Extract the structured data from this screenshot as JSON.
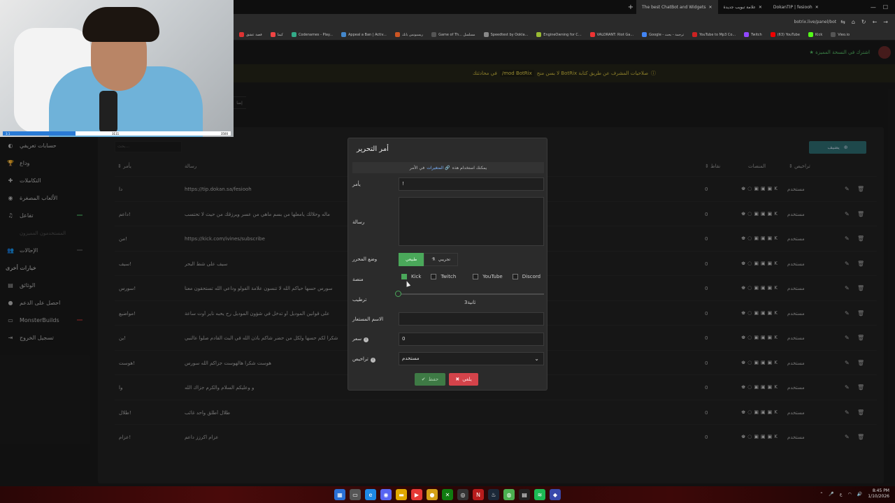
{
  "browser": {
    "tabs": [
      {
        "label": "The best ChatBot and Widgets",
        "active": true
      },
      {
        "label": "علامة تبويب جديدة",
        "active": false
      },
      {
        "label": "DokanTIP | fesiooh",
        "active": false
      }
    ],
    "url": "botrix.live/panel/bot",
    "bookmarks": [
      "قصة عشق",
      "كيما",
      "Codenames - Play...",
      "Appeal a Ban | Activ...",
      "ريسبونس بانك",
      "Game of Th... مسلسل",
      "Speedtest by Ookla...",
      "EngineOwning for C...",
      "VALORANT: Riot Ga...",
      "Google - ترجمة - بحث",
      "YouTube to Mp3 Co...",
      "Twitch",
      "(63) YouTube",
      "Kick",
      "Vieo.io"
    ]
  },
  "header": {
    "premium_link": "اشترك في النسخة المميزة",
    "notice_prefix": "في محادثتك",
    "notice_code": "/mod BotRix",
    "notice_suffix": "لا بسن منح BotRix صلاحيات المشرف عن طريق كتابة"
  },
  "webcam": {
    "bar_left": "3.1",
    "bar_mid": "3111",
    "bar_right": "3500",
    "progress": 0.32
  },
  "sidebar": {
    "items": [
      {
        "label": "حسابات تعريفي",
        "icon": "user-icon"
      },
      {
        "label": "وداع",
        "icon": "trophy-icon"
      },
      {
        "label": "التكاملات",
        "icon": "puzzle-icon"
      },
      {
        "label": "الألعاب المصغرة",
        "icon": "gamepad-icon"
      },
      {
        "label": "تفاعل",
        "icon": "music-icon"
      },
      {
        "label": "المستخدمون المميزون",
        "icon": "",
        "dim": true
      },
      {
        "label": "الإحالات",
        "icon": "users-icon"
      }
    ],
    "section_title": "خيارات أخرى",
    "other_items": [
      {
        "label": "الوثائق",
        "icon": "book-icon"
      },
      {
        "label": "احصل على الدعم",
        "icon": "support-icon"
      },
      {
        "label": "MonsterBuilds",
        "icon": "monitor-icon"
      },
      {
        "label": "تسجيل الخروج",
        "icon": "logout-icon"
      }
    ]
  },
  "table": {
    "add_label": "يضيف",
    "search_placeholder": "بحث...",
    "headers": {
      "command": "يأمر",
      "message": "رسالة",
      "points": "نقاط",
      "platforms": "المنصات",
      "permission": "تراخيص"
    },
    "rows": [
      {
        "command": "دا",
        "message": "https://tip.dokan.sa/fesiooh",
        "points": "0",
        "permission": "مستخدم"
      },
      {
        "command": "داعم!",
        "message": "ماله وحلالك يامعلها من بسم ماهي من عسر ويرزقك من حيث لا تحتسب",
        "points": "0",
        "permission": "مستخدم"
      },
      {
        "command": "من!",
        "message": "https://kick.com/ivines/subscribe",
        "points": "0",
        "permission": "مستخدم"
      },
      {
        "command": "سيف!",
        "message": "سيف على شط البحر",
        "points": "0",
        "permission": "مستخدم"
      },
      {
        "command": "سورس!",
        "message": "سورس حسها حياكم الله لا تنسون علامة الفولو وداعي الله تستحقون معنا",
        "points": "0",
        "permission": "مستخدم"
      },
      {
        "command": "مواضيع!",
        "message": "على قوانين الموديل أو تدخل في شؤون الموديل رح يحبه ناير أوت ساعة",
        "points": "0",
        "permission": "مستخدم"
      },
      {
        "command": "ين!",
        "message": "شكرا لكم حسها ولكل من حضر شاكم باذن الله في البث القادم صلوا عالنبي",
        "points": "0",
        "permission": "مستخدم"
      },
      {
        "command": "هوست!",
        "message": "هوست شكرا هالهوست جزاكم الله سورس",
        "points": "0",
        "permission": "مستخدم"
      },
      {
        "command": "وا",
        "message": "و وعليكم السلام والكرم جزاك الله",
        "points": "0",
        "permission": "مستخدم"
      },
      {
        "command": "طلال!",
        "message": "طلال أطلق واحد غائب",
        "points": "0",
        "permission": "مستخدم"
      },
      {
        "command": "عزام!",
        "message": "عزام اكرزز داعم",
        "points": "0",
        "permission": "مستخدم"
      }
    ]
  },
  "modal": {
    "title": "أمر التحرير",
    "hint_prefix": "في الأمر",
    "hint_link": "المتغيرات",
    "hint_suffix": "يمكنك استخدام هذه",
    "labels": {
      "command": "يأمر",
      "message": "رسالة",
      "editor_mode": "وضع المحرر",
      "platform": "منصة",
      "cooldown": "ترطيب",
      "alias": "الاسم المستعار",
      "price": "سعر",
      "permission": "تراخيص"
    },
    "values": {
      "command": "!",
      "message": "",
      "alias": "",
      "price": "0",
      "permission": "مستخدم",
      "cooldown": "3ثانية"
    },
    "mode_normal": "طبيعي",
    "mode_experimental": "تجريبي",
    "platforms": [
      {
        "name": "Kick",
        "checked": true
      },
      {
        "name": "Twitch",
        "checked": false
      },
      {
        "name": "YouTube",
        "checked": false
      },
      {
        "name": "Discord",
        "checked": false
      }
    ],
    "cooldown_fraction": 0.0,
    "save_label": "حفظ",
    "cancel_label": "يلغي"
  },
  "taskbar": {
    "time": "8:45 PM",
    "date": "1/10/2026",
    "lang": "ع"
  },
  "colors": {
    "accent_green": "#4aa85a",
    "cancel_red": "#d4434a",
    "premium_green": "#59c26a",
    "notice_yellow": "#d9c541"
  }
}
